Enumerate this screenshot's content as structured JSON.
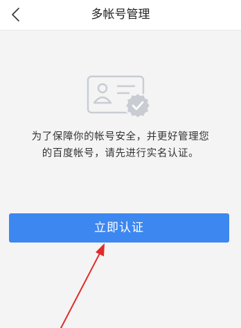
{
  "header": {
    "title": "多帐号管理",
    "back_icon": "chevron-left-icon"
  },
  "main": {
    "illustration_icon": "id-card-verified-icon",
    "notice": "为了保障你的帐号安全，并更好管理您的百度帐号，请先进行实名认证。",
    "verify_button_label": "立即认证"
  },
  "colors": {
    "button": "#3d87f0",
    "annotation_arrow": "#e02b2b",
    "background": "#f4f4f4",
    "illustration": "#c9ccd3"
  }
}
